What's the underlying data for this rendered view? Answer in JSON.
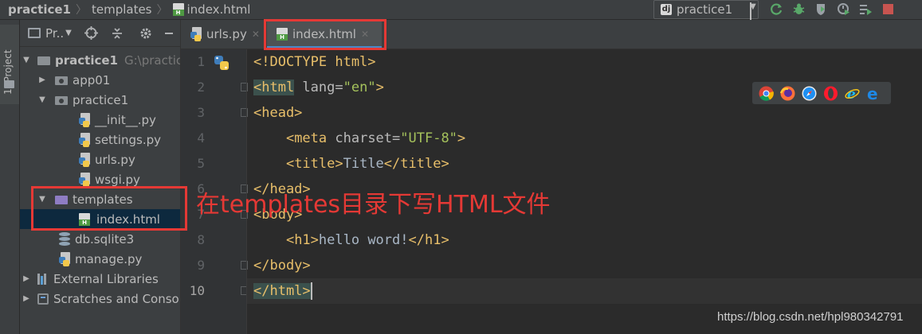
{
  "breadcrumb": {
    "project": "practice1",
    "folder": "templates",
    "file": "index.html"
  },
  "run_config": {
    "label": "practice1",
    "icon": "django-icon"
  },
  "toolbar_icons": [
    "rerun-icon",
    "debug-icon",
    "coverage-icon",
    "profile-icon",
    "run-tests-icon",
    "stop-icon"
  ],
  "tool_strip": {
    "tab_label": "1: Project"
  },
  "project_panel": {
    "title": "Pr..",
    "tree": [
      {
        "label": "practice1",
        "hint": "G:\\practice",
        "type": "folder",
        "expanded": true
      },
      {
        "label": "app01",
        "type": "folder",
        "expanded": false
      },
      {
        "label": "practice1",
        "type": "folder",
        "expanded": true
      },
      {
        "label": "__init__.py",
        "type": "python"
      },
      {
        "label": "settings.py",
        "type": "python"
      },
      {
        "label": "urls.py",
        "type": "python"
      },
      {
        "label": "wsgi.py",
        "type": "python"
      },
      {
        "label": "templates",
        "type": "folder-templates",
        "expanded": true
      },
      {
        "label": "index.html",
        "type": "html",
        "selected": true
      },
      {
        "label": "db.sqlite3",
        "type": "database"
      },
      {
        "label": "manage.py",
        "type": "python"
      },
      {
        "label": "External Libraries",
        "type": "libraries"
      },
      {
        "label": "Scratches and Conso",
        "type": "scratches"
      }
    ]
  },
  "editor_tabs": [
    {
      "label": "urls.py",
      "active": false
    },
    {
      "label": "index.html",
      "active": true
    }
  ],
  "editor": {
    "line_numbers": [
      "1",
      "2",
      "3",
      "4",
      "5",
      "6",
      "7",
      "8",
      "9",
      "10"
    ],
    "current_line": "10",
    "code": {
      "l1": "<!DOCTYPE html>",
      "l2_open": "<html",
      "l2_attr": " lang=",
      "l2_val": "\"en\"",
      "l2_close": ">",
      "l3": "<head>",
      "l4_open": "<meta",
      "l4_attr": " charset=",
      "l4_val": "\"UTF-8\"",
      "l4_close": ">",
      "l5_open": "<title>",
      "l5_text": "Title",
      "l5_close": "</title>",
      "l6": "</head>",
      "l7": "<body>",
      "l8_open": "<h1>",
      "l8_text": "hello word!",
      "l8_close": "</h1>",
      "l9": "</body>",
      "l10_open": "</html",
      "l10_close": ">"
    }
  },
  "browser_icons": [
    "chrome-icon",
    "firefox-icon",
    "safari-icon",
    "opera-icon",
    "ie-icon",
    "edge-icon"
  ],
  "annotation": {
    "text": "在templates目录下写HTML文件",
    "color": "#e53935"
  },
  "watermark": "https://blog.csdn.net/hpl980342791"
}
